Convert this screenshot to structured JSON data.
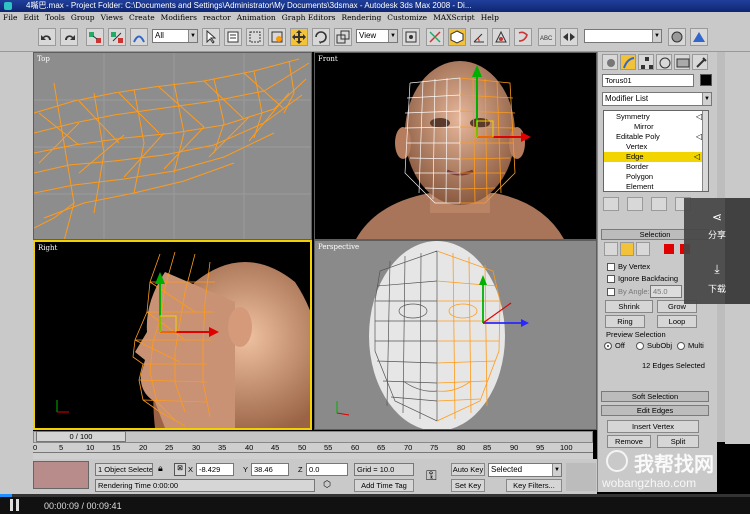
{
  "window": {
    "title": "4嘴巴.max   - Project Folder: C:\\Documents and Settings\\Administrator\\My Documents\\3dsmax   - Autodesk 3ds Max 2008      - Di..."
  },
  "menu": [
    "File",
    "Edit",
    "Tools",
    "Group",
    "Views",
    "Create",
    "Modifiers",
    "reactor",
    "Animation",
    "Graph Editors",
    "Rendering",
    "Customize",
    "MAXScript",
    "Help"
  ],
  "toolbar": {
    "selection_filter": "All",
    "reference_coord": "View"
  },
  "viewports": {
    "top": "Top",
    "front": "Front",
    "right": "Right",
    "perspective": "Perspective"
  },
  "command_panel": {
    "object_name": "Torus01",
    "modifier_list": "Modifier List",
    "stack": [
      "Symmetry",
      "Mirror",
      "Editable Poly",
      "Vertex",
      "Edge",
      "Border",
      "Polygon",
      "Element"
    ],
    "stack_selected": "Edge",
    "selection_rollout": "Selection",
    "by_vertex": "By Vertex",
    "ignore_backfacing": "Ignore Backfacing",
    "by_angle": "By Angle:",
    "angle_value": "45.0",
    "shrink": "Shrink",
    "grow": "Grow",
    "ring": "Ring",
    "loop": "Loop",
    "preview_selection": "Preview Selection",
    "preview_off": "Off",
    "preview_subobj": "SubObj",
    "preview_multi": "Multi",
    "selected_count": "12 Edges Selected",
    "soft_selection": "Soft Selection",
    "edit_edges": "Edit Edges",
    "insert_vertex": "Insert Vertex",
    "remove": "Remove",
    "split": "Split"
  },
  "timeline": {
    "slider": "0 / 100",
    "ticks": [
      "0",
      "5",
      "10",
      "15",
      "20",
      "25",
      "30",
      "35",
      "40",
      "45",
      "50",
      "55",
      "60",
      "65",
      "70",
      "75",
      "80",
      "85",
      "90",
      "95",
      "100"
    ]
  },
  "status": {
    "objects_selected": "1 Object Selecte",
    "x_label": "X",
    "x_value": "-8.429",
    "y_label": "Y",
    "y_value": "38.46",
    "z_label": "Z",
    "z_value": "0.0",
    "grid": "Grid = 10.0",
    "rendering_time": "Rendering Time  0:00:00",
    "add_time_tag": "Add Time Tag",
    "auto_key": "Auto Key",
    "selected": "Selected",
    "set_key": "Set Key",
    "key_filters": "Key Filters..."
  },
  "float_panel": {
    "share": "分享",
    "download": "下载"
  },
  "watermark": {
    "cn": "我帮找网",
    "url": "wobangzhao.com"
  },
  "player": {
    "time": "00:00:09 / 00:09:41"
  },
  "colors": {
    "wire": "#ff9b1a",
    "selection": "#f3d000",
    "gizmo_red": "#e00000",
    "gizmo_green": "#00b000"
  }
}
